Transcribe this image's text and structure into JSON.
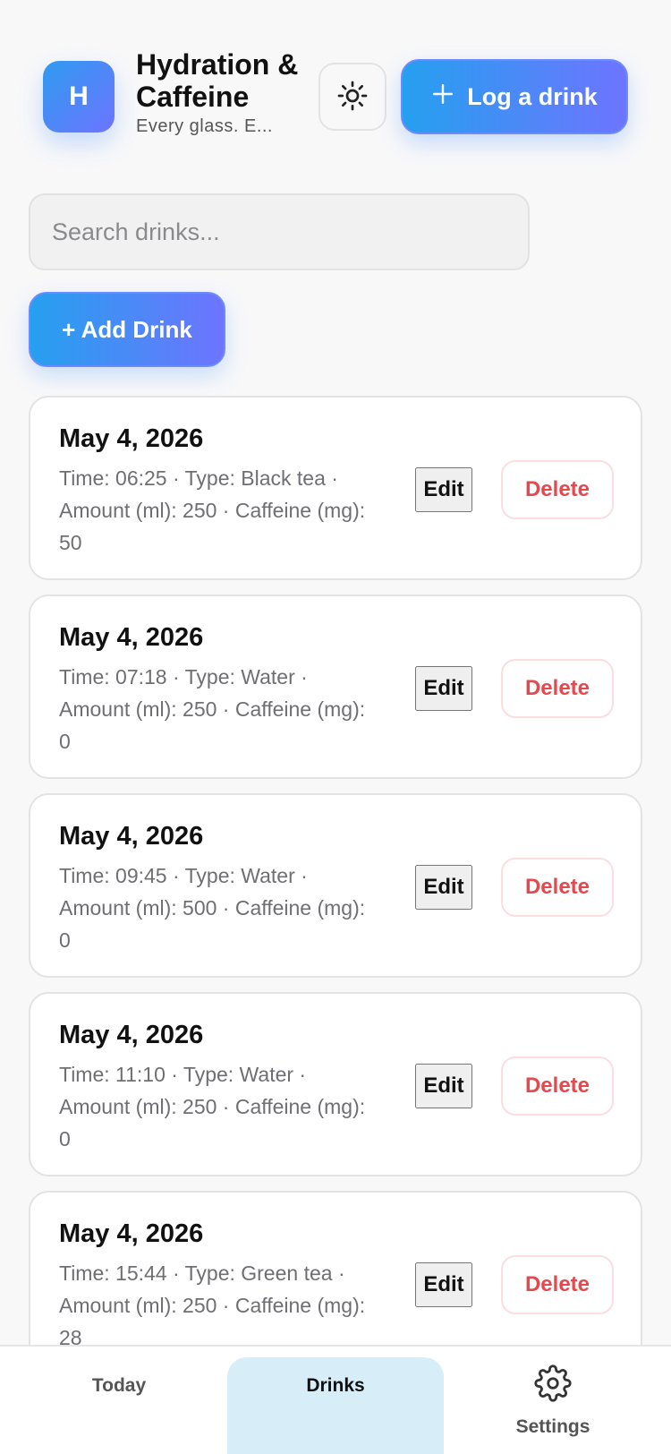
{
  "header": {
    "logo_letter": "H",
    "title": "Hydration & Caffeine",
    "tagline": "Every glass. E...",
    "theme_icon": "sun-icon",
    "log_button_label": "Log a drink",
    "log_button_icon": "plus-icon"
  },
  "search": {
    "placeholder": "Search drinks...",
    "value": ""
  },
  "add_button": {
    "label": "+ Add Drink"
  },
  "drinks": [
    {
      "date": "May 4, 2026",
      "details": "Time: 06:25 · Type: Black tea · Amount (ml): 250 · Caffeine (mg): 50",
      "edit_label": "Edit",
      "delete_label": "Delete"
    },
    {
      "date": "May 4, 2026",
      "details": "Time: 07:18 · Type: Water · Amount (ml): 250 · Caffeine (mg): 0",
      "edit_label": "Edit",
      "delete_label": "Delete"
    },
    {
      "date": "May 4, 2026",
      "details": "Time: 09:45 · Type: Water · Amount (ml): 500 · Caffeine (mg): 0",
      "edit_label": "Edit",
      "delete_label": "Delete"
    },
    {
      "date": "May 4, 2026",
      "details": "Time: 11:10 · Type: Water · Amount (ml): 250 · Caffeine (mg): 0",
      "edit_label": "Edit",
      "delete_label": "Delete"
    },
    {
      "date": "May 4, 2026",
      "details": "Time: 15:44 · Type: Green tea · Amount (ml): 250 · Caffeine (mg): 28",
      "edit_label": "Edit",
      "delete_label": "Delete"
    }
  ],
  "nav": {
    "items": [
      {
        "label": "Today",
        "active": false
      },
      {
        "label": "Drinks",
        "active": true
      },
      {
        "label": "Settings",
        "active": false,
        "icon": "gear-icon"
      }
    ]
  },
  "colors": {
    "accent_start": "#25a0ef",
    "accent_end": "#6e74ff",
    "delete": "#e5484d",
    "active_tab": "#d7eef9"
  }
}
